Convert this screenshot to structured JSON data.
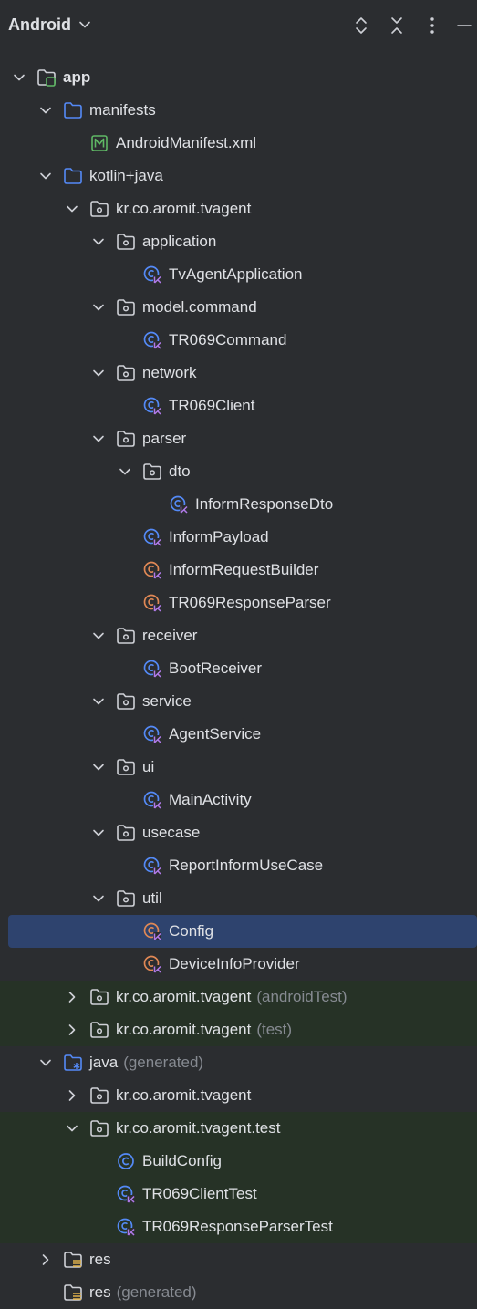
{
  "header": {
    "title": "Android"
  },
  "tree": [
    {
      "label": "app",
      "suffix": "",
      "depth": 0,
      "arrow": "down",
      "icon": "module-folder-icon",
      "bold": true
    },
    {
      "label": "manifests",
      "suffix": "",
      "depth": 1,
      "arrow": "down",
      "icon": "folder-icon"
    },
    {
      "label": "AndroidManifest.xml",
      "suffix": "",
      "depth": 2,
      "arrow": "none",
      "icon": "manifest-file-icon"
    },
    {
      "label": "kotlin+java",
      "suffix": "",
      "depth": 1,
      "arrow": "down",
      "icon": "folder-icon"
    },
    {
      "label": "kr.co.aromit.tvagent",
      "suffix": "",
      "depth": 2,
      "arrow": "down",
      "icon": "package-icon"
    },
    {
      "label": "application",
      "suffix": "",
      "depth": 3,
      "arrow": "down",
      "icon": "package-icon"
    },
    {
      "label": "TvAgentApplication",
      "suffix": "",
      "depth": 4,
      "arrow": "none",
      "icon": "kotlin-class-icon"
    },
    {
      "label": "model.command",
      "suffix": "",
      "depth": 3,
      "arrow": "down",
      "icon": "package-icon"
    },
    {
      "label": "TR069Command",
      "suffix": "",
      "depth": 4,
      "arrow": "none",
      "icon": "kotlin-class-icon"
    },
    {
      "label": "network",
      "suffix": "",
      "depth": 3,
      "arrow": "down",
      "icon": "package-icon"
    },
    {
      "label": "TR069Client",
      "suffix": "",
      "depth": 4,
      "arrow": "none",
      "icon": "kotlin-class-icon"
    },
    {
      "label": "parser",
      "suffix": "",
      "depth": 3,
      "arrow": "down",
      "icon": "package-icon"
    },
    {
      "label": "dto",
      "suffix": "",
      "depth": 4,
      "arrow": "down",
      "icon": "package-icon"
    },
    {
      "label": "InformResponseDto",
      "suffix": "",
      "depth": 5,
      "arrow": "none",
      "icon": "kotlin-class-icon"
    },
    {
      "label": "InformPayload",
      "suffix": "",
      "depth": 4,
      "arrow": "none",
      "icon": "kotlin-class-icon"
    },
    {
      "label": "InformRequestBuilder",
      "suffix": "",
      "depth": 4,
      "arrow": "none",
      "icon": "kotlin-object-icon"
    },
    {
      "label": "TR069ResponseParser",
      "suffix": "",
      "depth": 4,
      "arrow": "none",
      "icon": "kotlin-object-icon"
    },
    {
      "label": "receiver",
      "suffix": "",
      "depth": 3,
      "arrow": "down",
      "icon": "package-icon"
    },
    {
      "label": "BootReceiver",
      "suffix": "",
      "depth": 4,
      "arrow": "none",
      "icon": "kotlin-class-icon"
    },
    {
      "label": "service",
      "suffix": "",
      "depth": 3,
      "arrow": "down",
      "icon": "package-icon"
    },
    {
      "label": "AgentService",
      "suffix": "",
      "depth": 4,
      "arrow": "none",
      "icon": "kotlin-class-icon"
    },
    {
      "label": "ui",
      "suffix": "",
      "depth": 3,
      "arrow": "down",
      "icon": "package-icon"
    },
    {
      "label": "MainActivity",
      "suffix": "",
      "depth": 4,
      "arrow": "none",
      "icon": "kotlin-class-icon"
    },
    {
      "label": "usecase",
      "suffix": "",
      "depth": 3,
      "arrow": "down",
      "icon": "package-icon"
    },
    {
      "label": "ReportInformUseCase",
      "suffix": "",
      "depth": 4,
      "arrow": "none",
      "icon": "kotlin-class-icon"
    },
    {
      "label": "util",
      "suffix": "",
      "depth": 3,
      "arrow": "down",
      "icon": "package-icon"
    },
    {
      "label": "Config",
      "suffix": "",
      "depth": 4,
      "arrow": "none",
      "icon": "kotlin-object-icon",
      "selected": true
    },
    {
      "label": "DeviceInfoProvider",
      "suffix": "",
      "depth": 4,
      "arrow": "none",
      "icon": "kotlin-object-icon"
    },
    {
      "label": "kr.co.aromit.tvagent",
      "suffix": "(androidTest)",
      "depth": 2,
      "arrow": "right",
      "icon": "package-icon",
      "green": true
    },
    {
      "label": "kr.co.aromit.tvagent",
      "suffix": "(test)",
      "depth": 2,
      "arrow": "right",
      "icon": "package-icon",
      "green": true
    },
    {
      "label": "java",
      "suffix": "(generated)",
      "depth": 1,
      "arrow": "down",
      "icon": "generated-folder-icon"
    },
    {
      "label": "kr.co.aromit.tvagent",
      "suffix": "",
      "depth": 2,
      "arrow": "right",
      "icon": "package-icon"
    },
    {
      "label": "kr.co.aromit.tvagent.test",
      "suffix": "",
      "depth": 2,
      "arrow": "down",
      "icon": "package-icon",
      "green": true
    },
    {
      "label": "BuildConfig",
      "suffix": "",
      "depth": 3,
      "arrow": "none",
      "icon": "java-class-icon",
      "green": true
    },
    {
      "label": "TR069ClientTest",
      "suffix": "",
      "depth": 3,
      "arrow": "none",
      "icon": "kotlin-class-icon",
      "green": true
    },
    {
      "label": "TR069ResponseParserTest",
      "suffix": "",
      "depth": 3,
      "arrow": "none",
      "icon": "kotlin-class-icon",
      "green": true
    },
    {
      "label": "res",
      "suffix": "",
      "depth": 1,
      "arrow": "right",
      "icon": "resources-folder-icon"
    },
    {
      "label": "res",
      "suffix": "(generated)",
      "depth": 1,
      "arrow": "none",
      "icon": "resources-folder-icon"
    }
  ],
  "colors": {
    "background": "#2b2d30",
    "selected_row": "#2e436e",
    "test_row": "#263226",
    "text": "#dfe1e5",
    "muted_text": "#868a91",
    "kotlin_class_blue": "#548af7",
    "kotlin_object_orange": "#e08855",
    "manifest_green": "#5fb865"
  }
}
